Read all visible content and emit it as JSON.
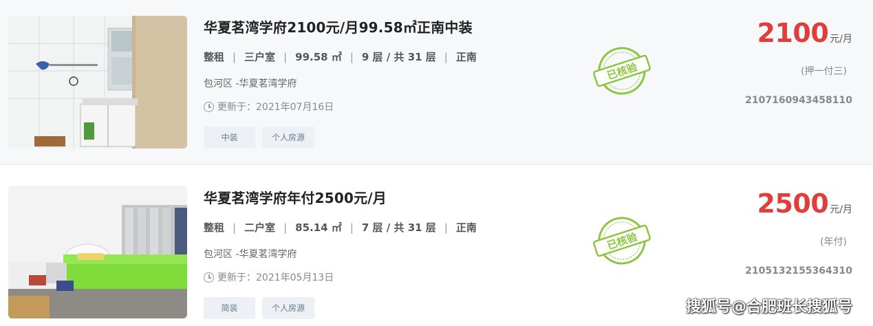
{
  "listings": [
    {
      "title": "华夏茗湾学府2100元/月99.58㎡正南中装",
      "rent_type": "整租",
      "rooms": "三户室",
      "area": "99.58 ㎡",
      "floor": "9 层 / 共 31 层",
      "orientation": "正南",
      "location": "包河区 -华夏茗湾学府",
      "updated": "更新于：2021年07月16日",
      "tags": [
        "中装",
        "个人房源"
      ],
      "verified_stamp": "已核验",
      "price": "2100",
      "price_unit": "元/月",
      "payment": "(押一付三)",
      "code": "2107160943458110"
    },
    {
      "title": "华夏茗湾学府年付2500元/月",
      "rent_type": "整租",
      "rooms": "二户室",
      "area": "85.14 ㎡",
      "floor": "7 层 / 共 31 层",
      "orientation": "正南",
      "location": "包河区 -华夏茗湾学府",
      "updated": "更新于：2021年05月13日",
      "tags": [
        "简装",
        "个人房源"
      ],
      "verified_stamp": "已核验",
      "price": "2500",
      "price_unit": "元/月",
      "payment": "(年付)",
      "code": "2105132155364310"
    }
  ],
  "watermark": "搜狐号@合肥班长搜狐号",
  "colors": {
    "price": "#e03e3a",
    "stamp": "#8cc63f",
    "tag_bg": "#edf1f6"
  }
}
